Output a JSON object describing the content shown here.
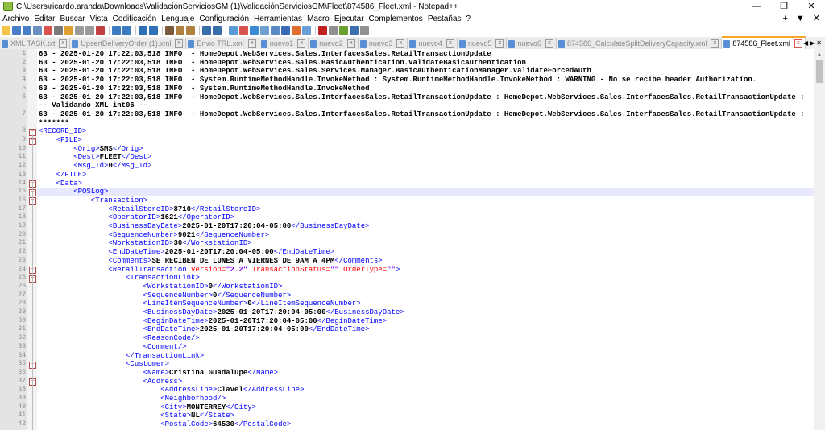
{
  "window": {
    "title": "C:\\Users\\ricardo.aranda\\Downloads\\ValidaciónServiciosGM (1)\\ValidaciónServiciosGM\\Fleet\\874586_Fleet.xml - Notepad++",
    "minimize": "—",
    "maximize": "❐",
    "close": "✕"
  },
  "menu": [
    "Archivo",
    "Editar",
    "Buscar",
    "Vista",
    "Codificación",
    "Lenguaje",
    "Configuración",
    "Herramientas",
    "Macro",
    "Ejecutar",
    "Complementos",
    "Pestañas",
    "?"
  ],
  "menu_right": [
    "+",
    "▼",
    "✕"
  ],
  "tabs": [
    {
      "label": "XML TASK.txt",
      "active": false
    },
    {
      "label": "UpsertDeliveryOrder (1).xml",
      "active": false
    },
    {
      "label": "Envio TRL.xml",
      "active": false
    },
    {
      "label": "nuevo1",
      "active": false
    },
    {
      "label": "nuevo2",
      "active": false
    },
    {
      "label": "nuevo3",
      "active": false
    },
    {
      "label": "nuevo4",
      "active": false
    },
    {
      "label": "nuevo5",
      "active": false
    },
    {
      "label": "nuevo6",
      "active": false
    },
    {
      "label": "874586_CalculateSplitDeliveryCapacity.xml",
      "active": false
    },
    {
      "label": "874586_Fleet.xml",
      "active": true
    }
  ],
  "tab_close": "x",
  "tab_nav": [
    "◀",
    "▶",
    "✕"
  ],
  "lines": [
    {
      "n": "1",
      "t": "log",
      "s": "63 - 2025-01-20 17:22:03,518 INFO  - HomeDepot.WebServices.Sales.InterfacesSales.RetailTransactionUpdate"
    },
    {
      "n": "2",
      "t": "log",
      "s": "63 - 2025-01-20 17:22:03,518 INFO  - HomeDepot.WebServices.Sales.BasicAuthentication.ValidateBasicAuthentication"
    },
    {
      "n": "3",
      "t": "log",
      "s": "63 - 2025-01-20 17:22:03,518 INFO  - HomeDepot.WebServices.Sales.Services.Manager.BasicAuthenticationManager.ValidateForcedAuth"
    },
    {
      "n": "4",
      "t": "log",
      "s": "63 - 2025-01-20 17:22:03,518 INFO  - System.RuntimeMethodHandle.InvokeMethod : System.RuntimeMethodHandle.InvokeMethod : WARNING - No se recibe header Authorization."
    },
    {
      "n": "5",
      "t": "log",
      "s": "63 - 2025-01-20 17:22:03,518 INFO  - System.RuntimeMethodHandle.InvokeMethod"
    },
    {
      "n": "6",
      "t": "log",
      "s": "63 - 2025-01-20 17:22:03,518 INFO  - HomeDepot.WebServices.Sales.InterfacesSales.RetailTransactionUpdate : HomeDepot.WebServices.Sales.InterfacesSales.RetailTransactionUpdate :"
    },
    {
      "n": "",
      "t": "log",
      "s": "-- Validando XML int06 --"
    },
    {
      "n": "7",
      "t": "log",
      "s": "63 - 2025-01-20 17:22:03,518 INFO  - HomeDepot.WebServices.Sales.InterfacesSales.RetailTransactionUpdate : HomeDepot.WebServices.Sales.InterfacesSales.RetailTransactionUpdate :"
    },
    {
      "n": "",
      "t": "log",
      "s": "*******"
    },
    {
      "n": "8",
      "t": "x",
      "i": 0,
      "open": "RECORD_ID"
    },
    {
      "n": "9",
      "t": "x",
      "i": 1,
      "open": "FILE"
    },
    {
      "n": "10",
      "t": "x",
      "i": 2,
      "open": "Orig",
      "val": "SMS",
      "close": "Orig"
    },
    {
      "n": "11",
      "t": "x",
      "i": 2,
      "open": "Dest",
      "val": "FLEET",
      "close": "Dest"
    },
    {
      "n": "12",
      "t": "x",
      "i": 2,
      "open": "Msg_Id",
      "val": "0",
      "close": "Msg_Id"
    },
    {
      "n": "13",
      "t": "x",
      "i": 1,
      "close": "FILE"
    },
    {
      "n": "14",
      "t": "x",
      "i": 1,
      "open": "Data"
    },
    {
      "n": "15",
      "t": "x",
      "i": 2,
      "open": "POSLog",
      "caret": true
    },
    {
      "n": "16",
      "t": "x",
      "i": 3,
      "open": "Transaction"
    },
    {
      "n": "17",
      "t": "x",
      "i": 4,
      "open": "RetailStoreID",
      "val": "8710",
      "close": "RetailStoreID"
    },
    {
      "n": "18",
      "t": "x",
      "i": 4,
      "open": "OperatorID",
      "val": "1621",
      "close": "OperatorID"
    },
    {
      "n": "19",
      "t": "x",
      "i": 4,
      "open": "BusinessDayDate",
      "val": "2025-01-20T17:20:04-05:00",
      "close": "BusinessDayDate"
    },
    {
      "n": "20",
      "t": "x",
      "i": 4,
      "open": "SequenceNumber",
      "val": "9021",
      "close": "SequenceNumber"
    },
    {
      "n": "21",
      "t": "x",
      "i": 4,
      "open": "WorkstationID",
      "val": "30",
      "close": "WorkstationID"
    },
    {
      "n": "22",
      "t": "x",
      "i": 4,
      "open": "EndDateTime",
      "val": "2025-01-20T17:20:04-05:00",
      "close": "EndDateTime"
    },
    {
      "n": "23",
      "t": "x",
      "i": 4,
      "open": "Comments",
      "val": "SE RECIBEN DE LUNES A VIERNES DE 9AM A 4PM",
      "close": "Comments"
    },
    {
      "n": "24",
      "t": "rt",
      "i": 4,
      "tagname": "RetailTransaction",
      "a1": "Version",
      "v1": "\"2.2\"",
      "a2": "TransactionStatus",
      "v2": "\"\"",
      "a3": "OrderType",
      "v3": "\"\""
    },
    {
      "n": "25",
      "t": "x",
      "i": 5,
      "open": "TransactionLink"
    },
    {
      "n": "26",
      "t": "x",
      "i": 6,
      "open": "WorkstationID",
      "val": "0",
      "close": "WorkstationID"
    },
    {
      "n": "27",
      "t": "x",
      "i": 6,
      "open": "SequenceNumber",
      "val": "0",
      "close": "SequenceNumber"
    },
    {
      "n": "28",
      "t": "x",
      "i": 6,
      "open": "LineItemSequenceNumber",
      "val": "0",
      "close": "LineItemSequenceNumber"
    },
    {
      "n": "29",
      "t": "x",
      "i": 6,
      "open": "BusinessDayDate",
      "val": "2025-01-20T17:20:04-05:00",
      "close": "BusinessDayDate"
    },
    {
      "n": "30",
      "t": "x",
      "i": 6,
      "open": "BeginDateTime",
      "val": "2025-01-20T17:20:04-05:00",
      "close": "BeginDateTime"
    },
    {
      "n": "31",
      "t": "x",
      "i": 6,
      "open": "EndDateTime",
      "val": "2025-01-20T17:20:04-05:00",
      "close": "EndDateTime"
    },
    {
      "n": "32",
      "t": "x",
      "i": 6,
      "selfclose": "ReasonCode"
    },
    {
      "n": "33",
      "t": "x",
      "i": 6,
      "selfclose": "Comment"
    },
    {
      "n": "34",
      "t": "x",
      "i": 5,
      "close": "TransactionLink"
    },
    {
      "n": "35",
      "t": "x",
      "i": 5,
      "open": "Customer"
    },
    {
      "n": "36",
      "t": "x",
      "i": 6,
      "open": "Name",
      "val": "Cristina Guadalupe",
      "close": "Name"
    },
    {
      "n": "37",
      "t": "x",
      "i": 6,
      "open": "Address"
    },
    {
      "n": "38",
      "t": "x",
      "i": 7,
      "open": "AddressLine",
      "val": "Clavel",
      "close": "AddressLine"
    },
    {
      "n": "39",
      "t": "x",
      "i": 7,
      "selfclose": "Neighborhood"
    },
    {
      "n": "40",
      "t": "x",
      "i": 7,
      "open": "City",
      "val": "MONTERREY",
      "close": "City"
    },
    {
      "n": "41",
      "t": "x",
      "i": 7,
      "open": "State",
      "val": "NL",
      "close": "State"
    },
    {
      "n": "42",
      "t": "x",
      "i": 7,
      "open": "PostalCode",
      "val": "64530",
      "close": "PostalCode"
    }
  ],
  "folds": [
    "8",
    "9",
    "14",
    "15",
    "16",
    "24",
    "25",
    "35",
    "37"
  ]
}
